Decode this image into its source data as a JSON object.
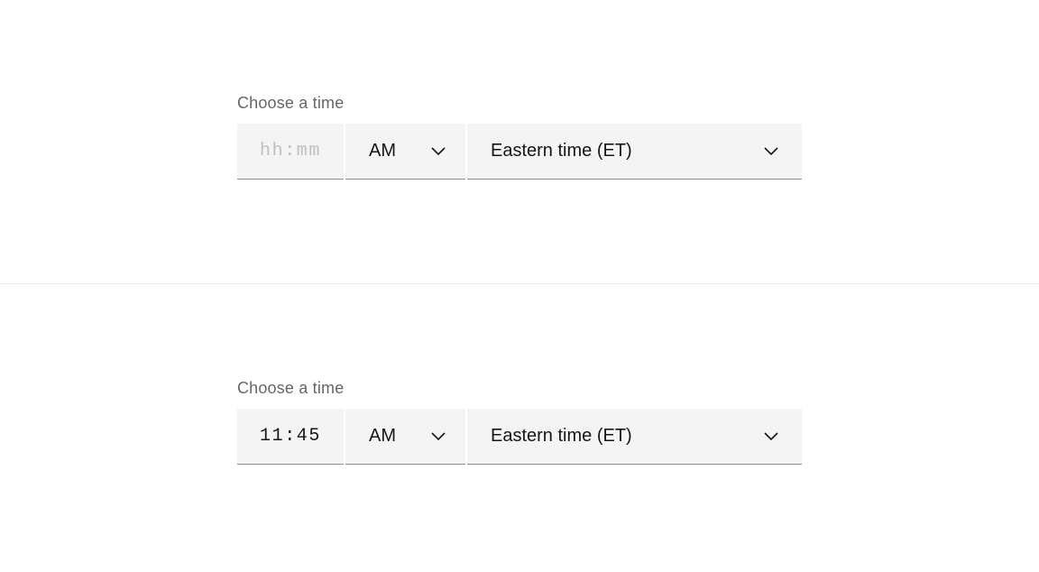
{
  "fields": [
    {
      "label": "Choose a time",
      "time_value": "",
      "time_placeholder": "hh:mm",
      "ampm_value": "AM",
      "timezone_value": "Eastern time (ET)"
    },
    {
      "label": "Choose a time",
      "time_value": "11:45",
      "time_placeholder": "hh:mm",
      "ampm_value": "AM",
      "timezone_value": "Eastern time (ET)"
    }
  ]
}
